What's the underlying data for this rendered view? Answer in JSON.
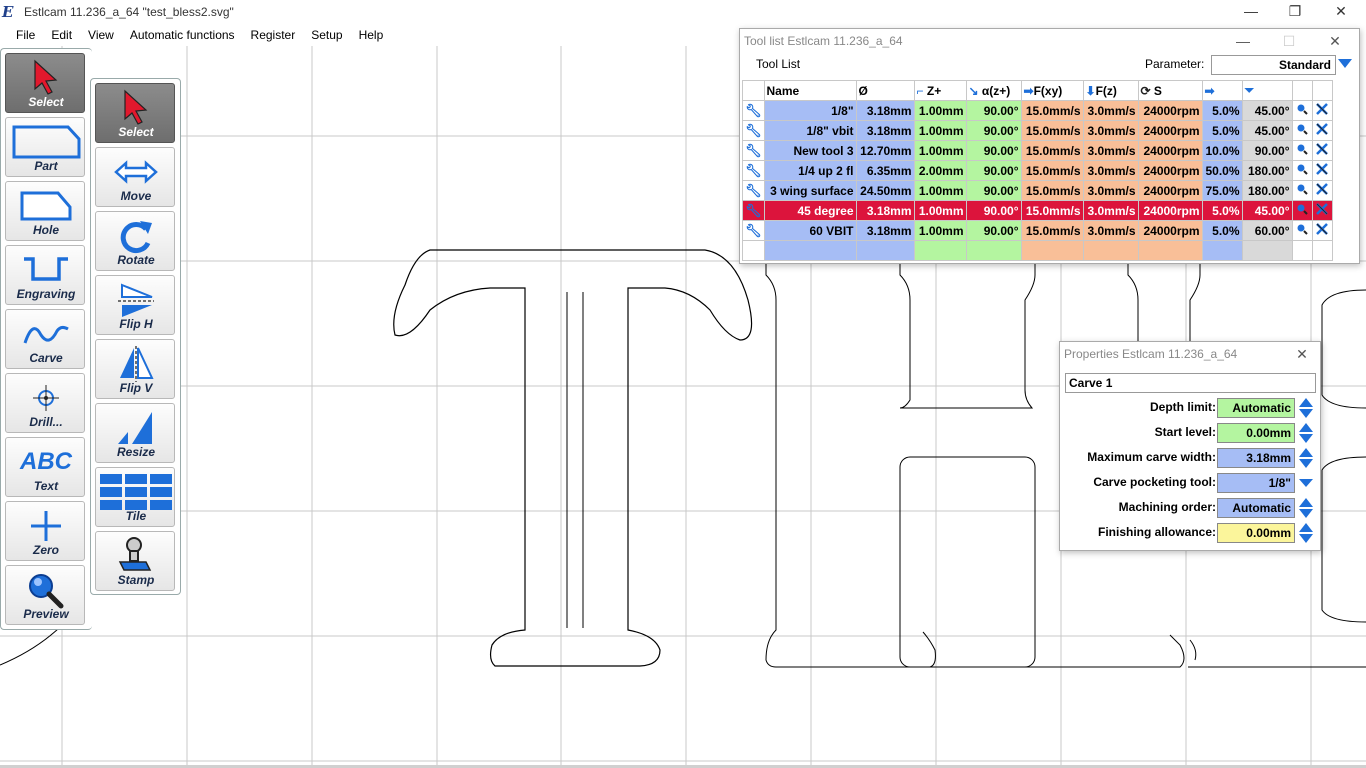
{
  "window": {
    "title": "Estlcam 11.236_a_64 \"test_bless2.svg\"",
    "min_label": "—",
    "restore_label": "❐",
    "close_label": "✕"
  },
  "menu": [
    "File",
    "Edit",
    "View",
    "Automatic functions",
    "Register",
    "Setup",
    "Help"
  ],
  "left_toolbar": [
    {
      "label": "Select",
      "icon": "pointer-icon",
      "active": true
    },
    {
      "label": "Part",
      "icon": "part-icon"
    },
    {
      "label": "Hole",
      "icon": "hole-icon"
    },
    {
      "label": "Engraving",
      "icon": "engraving-icon"
    },
    {
      "label": "Carve",
      "icon": "carve-icon"
    },
    {
      "label": "Drill...",
      "icon": "drill-icon"
    },
    {
      "label": "Text",
      "icon": "text-icon",
      "glyph": "ABC"
    },
    {
      "label": "Zero",
      "icon": "zero-icon"
    },
    {
      "label": "Preview",
      "icon": "preview-icon"
    }
  ],
  "edit_toolbar": [
    {
      "label": "Select",
      "icon": "pointer-icon",
      "active": true
    },
    {
      "label": "Move",
      "icon": "move-icon"
    },
    {
      "label": "Rotate",
      "icon": "rotate-icon"
    },
    {
      "label": "Flip H",
      "icon": "flip-h-icon"
    },
    {
      "label": "Flip V",
      "icon": "flip-v-icon"
    },
    {
      "label": "Resize",
      "icon": "resize-icon"
    },
    {
      "label": "Tile",
      "icon": "tile-icon"
    },
    {
      "label": "Stamp",
      "icon": "stamp-icon"
    }
  ],
  "toollist": {
    "title": "Tool list Estlcam 11.236_a_64",
    "tab": "Tool List",
    "parameter_label": "Parameter:",
    "parameter_value": "Standard",
    "headers": [
      "Name",
      "Ø",
      "Z+",
      "α(z+)",
      "F(xy)",
      "F(z)",
      "S"
    ],
    "rows": [
      [
        "1/8\"",
        "3.18mm",
        "1.00mm",
        "90.00°",
        "15.0mm/s",
        "3.0mm/s",
        "24000rpm",
        "5.0%",
        "45.00°"
      ],
      [
        "1/8\" vbit",
        "3.18mm",
        "1.00mm",
        "90.00°",
        "15.0mm/s",
        "3.0mm/s",
        "24000rpm",
        "5.0%",
        "45.00°"
      ],
      [
        "New tool 3",
        "12.70mm",
        "1.00mm",
        "90.00°",
        "15.0mm/s",
        "3.0mm/s",
        "24000rpm",
        "10.0%",
        "90.00°"
      ],
      [
        "1/4 up 2 fl",
        "6.35mm",
        "2.00mm",
        "90.00°",
        "15.0mm/s",
        "3.0mm/s",
        "24000rpm",
        "50.0%",
        "180.00°"
      ],
      [
        "3 wing surface",
        "24.50mm",
        "1.00mm",
        "90.00°",
        "15.0mm/s",
        "3.0mm/s",
        "24000rpm",
        "75.0%",
        "180.00°"
      ],
      [
        "45 degree",
        "3.18mm",
        "1.00mm",
        "90.00°",
        "15.0mm/s",
        "3.0mm/s",
        "24000rpm",
        "5.0%",
        "45.00°"
      ],
      [
        "60 VBIT",
        "3.18mm",
        "1.00mm",
        "90.00°",
        "15.0mm/s",
        "3.0mm/s",
        "24000rpm",
        "5.0%",
        "60.00°"
      ]
    ],
    "selected_row": 5
  },
  "properties": {
    "title": "Properties Estlcam 11.236_a_64",
    "name": "Carve 1",
    "fields": [
      {
        "label": "Depth limit:",
        "value": "Automatic",
        "color": "green",
        "control": "spin"
      },
      {
        "label": "Start level:",
        "value": "0.00mm",
        "color": "green",
        "control": "spin"
      },
      {
        "label": "Maximum carve width:",
        "value": "3.18mm",
        "color": "blue",
        "control": "spin"
      },
      {
        "label": "Carve pocketing tool:",
        "value": "1/8\"",
        "color": "blue",
        "control": "dropdown"
      },
      {
        "label": "Machining order:",
        "value": "Automatic",
        "color": "blue",
        "control": "spin"
      },
      {
        "label": "Finishing allowance:",
        "value": "0.00mm",
        "color": "yellow",
        "control": "spin"
      }
    ]
  },
  "colors": {
    "toolpath": "#c8102e",
    "accent": "#1e6fd9",
    "selected_row": "#dc143c"
  }
}
